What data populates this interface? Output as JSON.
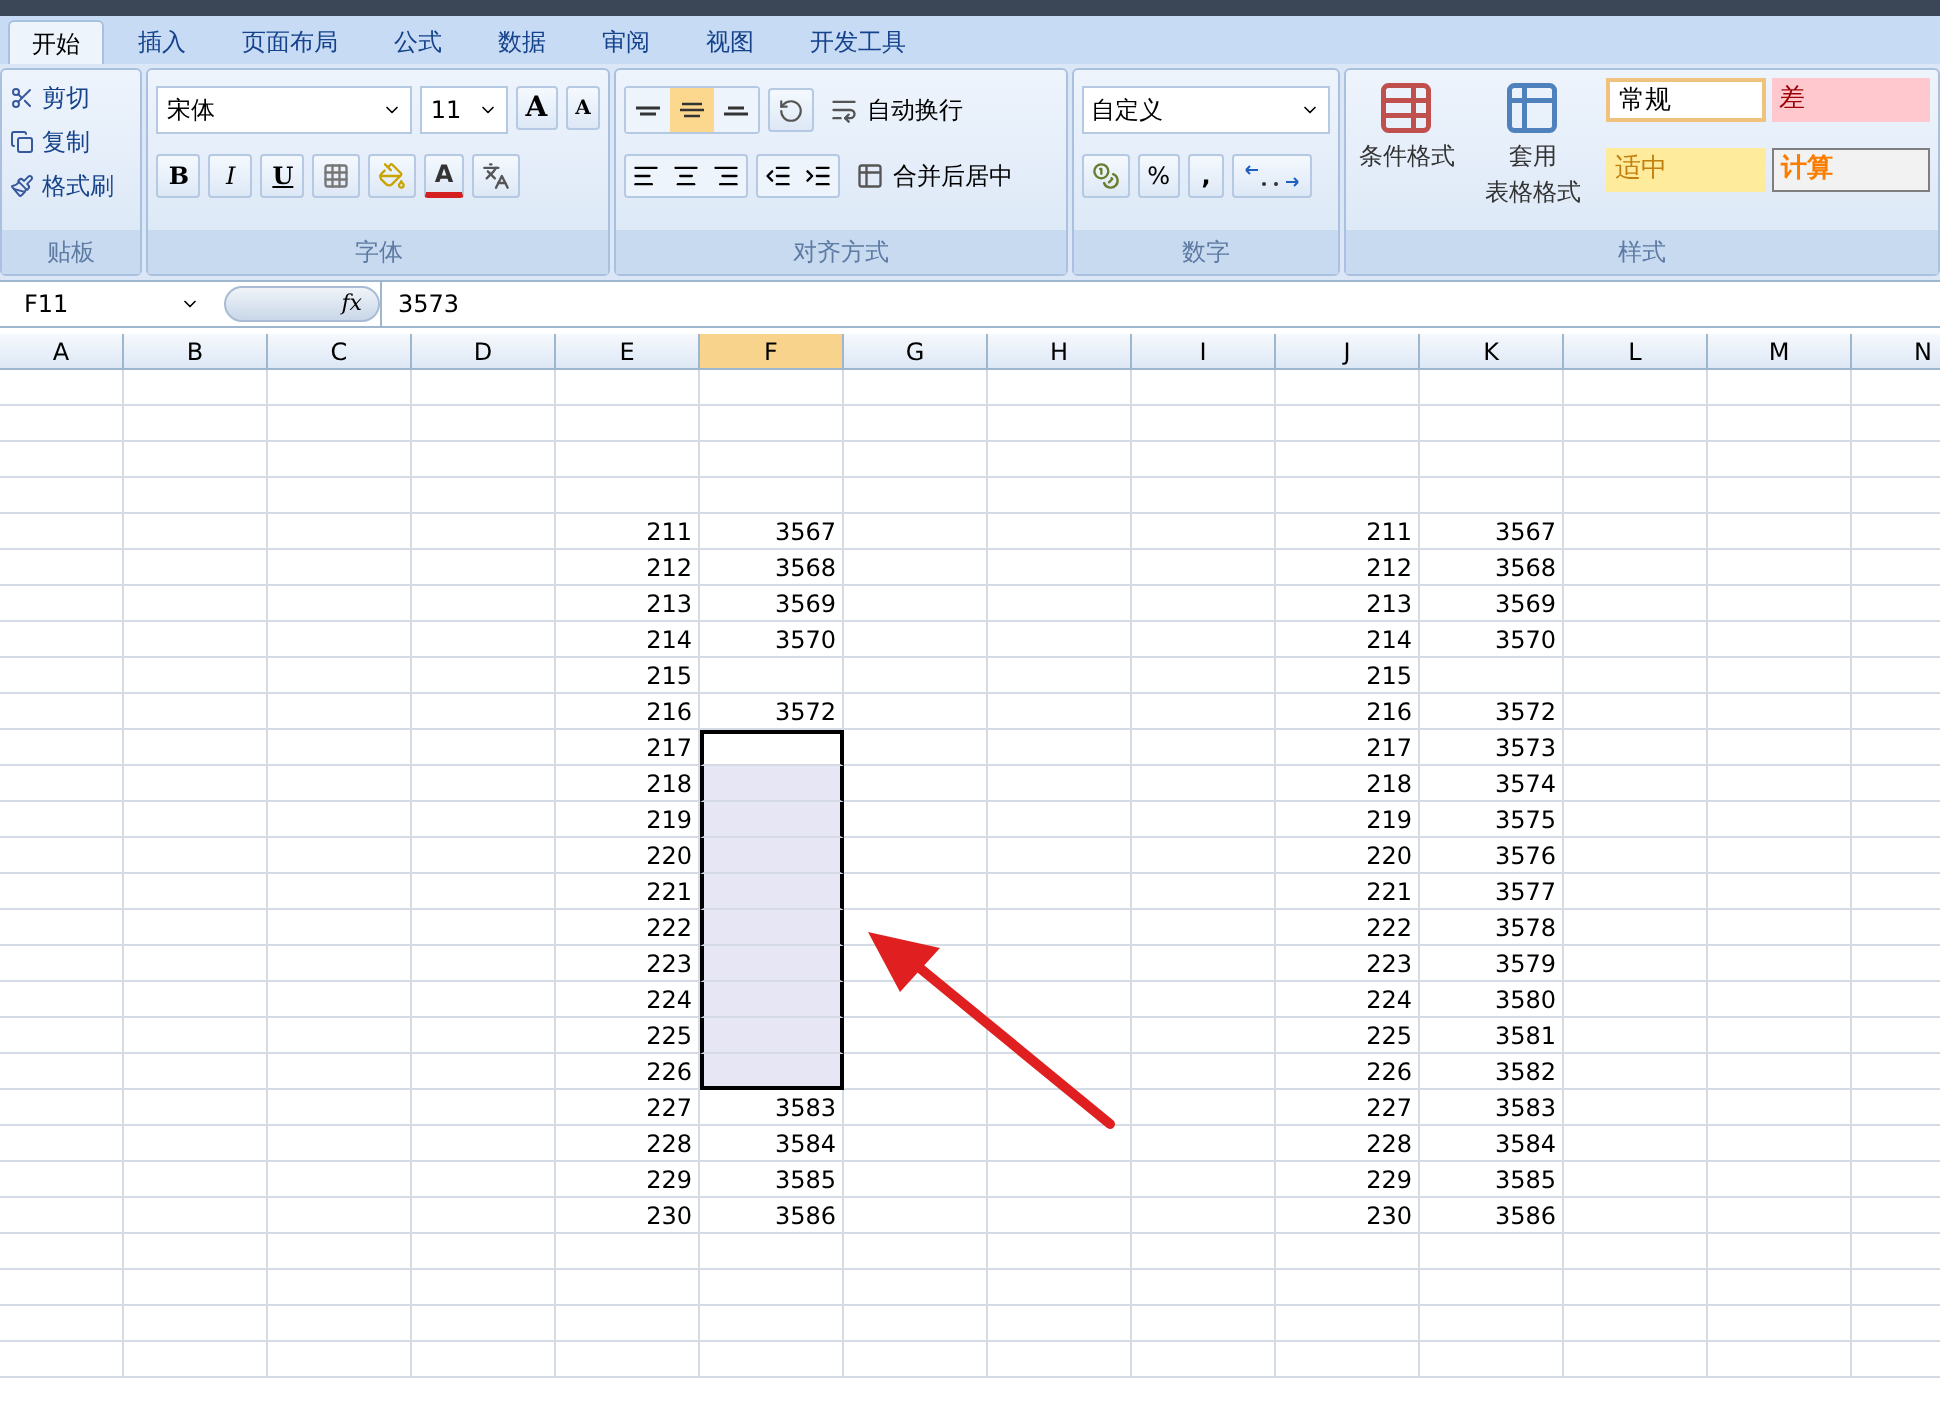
{
  "tabs": [
    {
      "label": "开始",
      "selected": true
    },
    {
      "label": "插入",
      "selected": false
    },
    {
      "label": "页面布局",
      "selected": false
    },
    {
      "label": "公式",
      "selected": false
    },
    {
      "label": "数据",
      "selected": false
    },
    {
      "label": "审阅",
      "selected": false
    },
    {
      "label": "视图",
      "selected": false
    },
    {
      "label": "开发工具",
      "selected": false
    }
  ],
  "clipboard": {
    "items": [
      "剪切",
      "复制",
      "格式刷"
    ],
    "label": "贴板"
  },
  "font": {
    "name": "宋体",
    "size": "11",
    "grow": "A",
    "shrink": "A",
    "bold": "B",
    "italic": "I",
    "underline": "U",
    "color_letter": "A",
    "label": "字体"
  },
  "alignment": {
    "vertical": [
      {
        "selected": false
      },
      {
        "selected": true
      },
      {
        "selected": false
      }
    ],
    "wrap": "自动换行",
    "merge": "合并后居中",
    "label": "对齐方式"
  },
  "number": {
    "format": "自定义",
    "percent": "%",
    "comma": ",",
    "label": "数字"
  },
  "styles": {
    "conditional": "条件格式",
    "table_line1": "套用",
    "table_line2": "表格格式",
    "label": "样式",
    "cells": [
      {
        "text": "常规",
        "kind": "normal"
      },
      {
        "text": "差",
        "kind": "bad"
      },
      {
        "text": "适中",
        "kind": "neutral"
      },
      {
        "text": "计算",
        "kind": "calc"
      }
    ]
  },
  "formula_bar": {
    "name_box": "F11",
    "fx": "fx",
    "value": "3573"
  },
  "columns": [
    {
      "label": "A",
      "selected": false
    },
    {
      "label": "B",
      "selected": false
    },
    {
      "label": "C",
      "selected": false
    },
    {
      "label": "D",
      "selected": false
    },
    {
      "label": "E",
      "selected": false
    },
    {
      "label": "F",
      "selected": true
    },
    {
      "label": "G",
      "selected": false
    },
    {
      "label": "H",
      "selected": false
    },
    {
      "label": "I",
      "selected": false
    },
    {
      "label": "J",
      "selected": false
    },
    {
      "label": "K",
      "selected": false
    },
    {
      "label": "L",
      "selected": false
    },
    {
      "label": "M",
      "selected": false
    },
    {
      "label": "N",
      "selected": false
    }
  ],
  "rows": [
    {
      "e": "211",
      "f": "3567",
      "j": "211",
      "k": "3567",
      "selected": false,
      "active": false
    },
    {
      "e": "212",
      "f": "3568",
      "j": "212",
      "k": "3568",
      "selected": false,
      "active": false
    },
    {
      "e": "213",
      "f": "3569",
      "j": "213",
      "k": "3569",
      "selected": false,
      "active": false
    },
    {
      "e": "214",
      "f": "3570",
      "j": "214",
      "k": "3570",
      "selected": false,
      "active": false
    },
    {
      "e": "215",
      "j": "215",
      "selected": false,
      "active": false
    },
    {
      "e": "216",
      "f": "3572",
      "j": "216",
      "k": "3572",
      "selected": false,
      "active": false
    },
    {
      "e": "217",
      "j": "217",
      "k": "3573",
      "selected": true,
      "active": true
    },
    {
      "e": "218",
      "j": "218",
      "k": "3574",
      "selected": true,
      "active": false
    },
    {
      "e": "219",
      "j": "219",
      "k": "3575",
      "selected": true,
      "active": false
    },
    {
      "e": "220",
      "j": "220",
      "k": "3576",
      "selected": true,
      "active": false
    },
    {
      "e": "221",
      "j": "221",
      "k": "3577",
      "selected": true,
      "active": false
    },
    {
      "e": "222",
      "j": "222",
      "k": "3578",
      "selected": true,
      "active": false
    },
    {
      "e": "223",
      "j": "223",
      "k": "3579",
      "selected": true,
      "active": false
    },
    {
      "e": "224",
      "j": "224",
      "k": "3580",
      "selected": true,
      "active": false
    },
    {
      "e": "225",
      "j": "225",
      "k": "3581",
      "selected": true,
      "active": false
    },
    {
      "e": "226",
      "j": "226",
      "k": "3582",
      "selected": true,
      "active": false
    },
    {
      "e": "227",
      "f": "3583",
      "j": "227",
      "k": "3583",
      "selected": false,
      "active": false
    },
    {
      "e": "228",
      "f": "3584",
      "j": "228",
      "k": "3584",
      "selected": false,
      "active": false
    },
    {
      "e": "229",
      "f": "3585",
      "j": "229",
      "k": "3585",
      "selected": false,
      "active": false
    },
    {
      "e": "230",
      "f": "3586",
      "j": "230",
      "k": "3586",
      "selected": false,
      "active": false
    }
  ]
}
